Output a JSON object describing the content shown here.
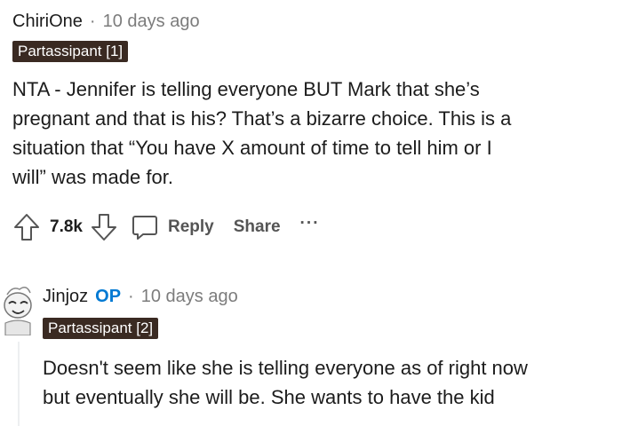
{
  "comments": [
    {
      "author": "ChiriOne",
      "separator": "·",
      "time": "10 days ago",
      "flair": "Partassipant [1]",
      "body_lines": [
        "NTA - Jennifer is telling everyone BUT Mark that she’s",
        "pregnant and that is his? That’s a bizarre choice. This is a",
        "situation that “You have X amount of time to tell him or I",
        "will” was made for."
      ],
      "vote_count": "7.8k",
      "reply_label": "Reply",
      "share_label": "Share",
      "more_label": "···"
    },
    {
      "author": "Jinjoz",
      "op_badge": "OP",
      "separator": "·",
      "time": "10 days ago",
      "flair": "Partassipant [2]",
      "body_lines": [
        "Doesn't seem like she is telling everyone as of right now",
        "but eventually she will be. She wants to have the kid"
      ]
    }
  ],
  "colors": {
    "flair_bg": "#3a2a22",
    "op": "#0079d3",
    "muted": "#7c7c7c",
    "text": "#1c1c1c"
  }
}
